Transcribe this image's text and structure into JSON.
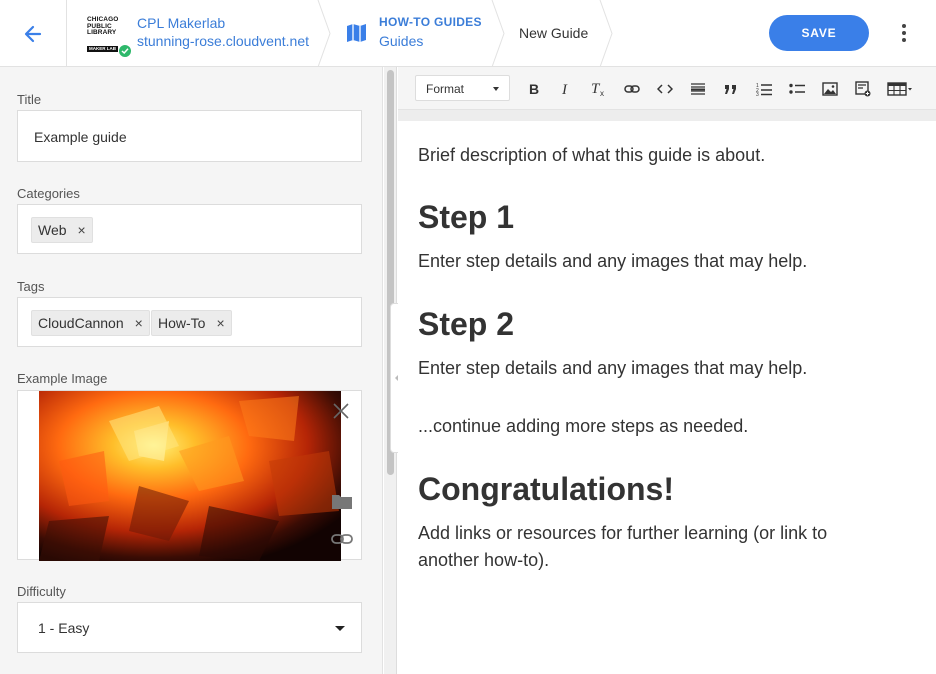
{
  "header": {
    "back_icon": "arrow-left-icon",
    "logo": {
      "lines": [
        "CHICAGO",
        "PUBLIC",
        "LIBRARY"
      ],
      "badge": "MAKER LAB",
      "status_icon": "check-circle-icon"
    },
    "site_name": "CPL Makerlab",
    "site_url": "stunning-rose.cloudvent.net",
    "collection_icon": "map-icon",
    "collection_label": "HOW-TO GUIDES",
    "collection_name": "Guides",
    "doc_title": "New Guide",
    "save_label": "SAVE",
    "menu_icon": "more-vertical-icon",
    "accent_color": "#3a7fe8"
  },
  "sidebar": {
    "title_field": {
      "label": "Title",
      "value": "Example guide"
    },
    "categories_field": {
      "label": "Categories",
      "chips": [
        "Web"
      ]
    },
    "tags_field": {
      "label": "Tags",
      "chips": [
        "CloudCannon",
        "How-To"
      ]
    },
    "image_field": {
      "label": "Example Image",
      "tools": [
        "close-icon",
        "folder-icon",
        "link-icon"
      ]
    },
    "difficulty_field": {
      "label": "Difficulty",
      "value": "1 - Easy"
    }
  },
  "toolbar": {
    "format_label": "Format",
    "buttons": [
      "bold-icon",
      "italic-icon",
      "clear-format-icon",
      "link-icon",
      "code-icon",
      "horizontal-rule-icon",
      "blockquote-icon",
      "ordered-list-icon",
      "unordered-list-icon",
      "image-icon",
      "snippet-icon",
      "table-icon"
    ]
  },
  "content": {
    "intro": "Brief description of what this guide is about.",
    "step1_heading": "Step 1",
    "step1_text": "Enter step details and any images that may help.",
    "step2_heading": "Step 2",
    "step2_text": "Enter step details and any images that may help.",
    "continue_text": "...continue adding more steps as needed.",
    "congrats_heading": "Congratulations!",
    "congrats_text": "Add links or resources for further learning (or link to another how-to)."
  }
}
